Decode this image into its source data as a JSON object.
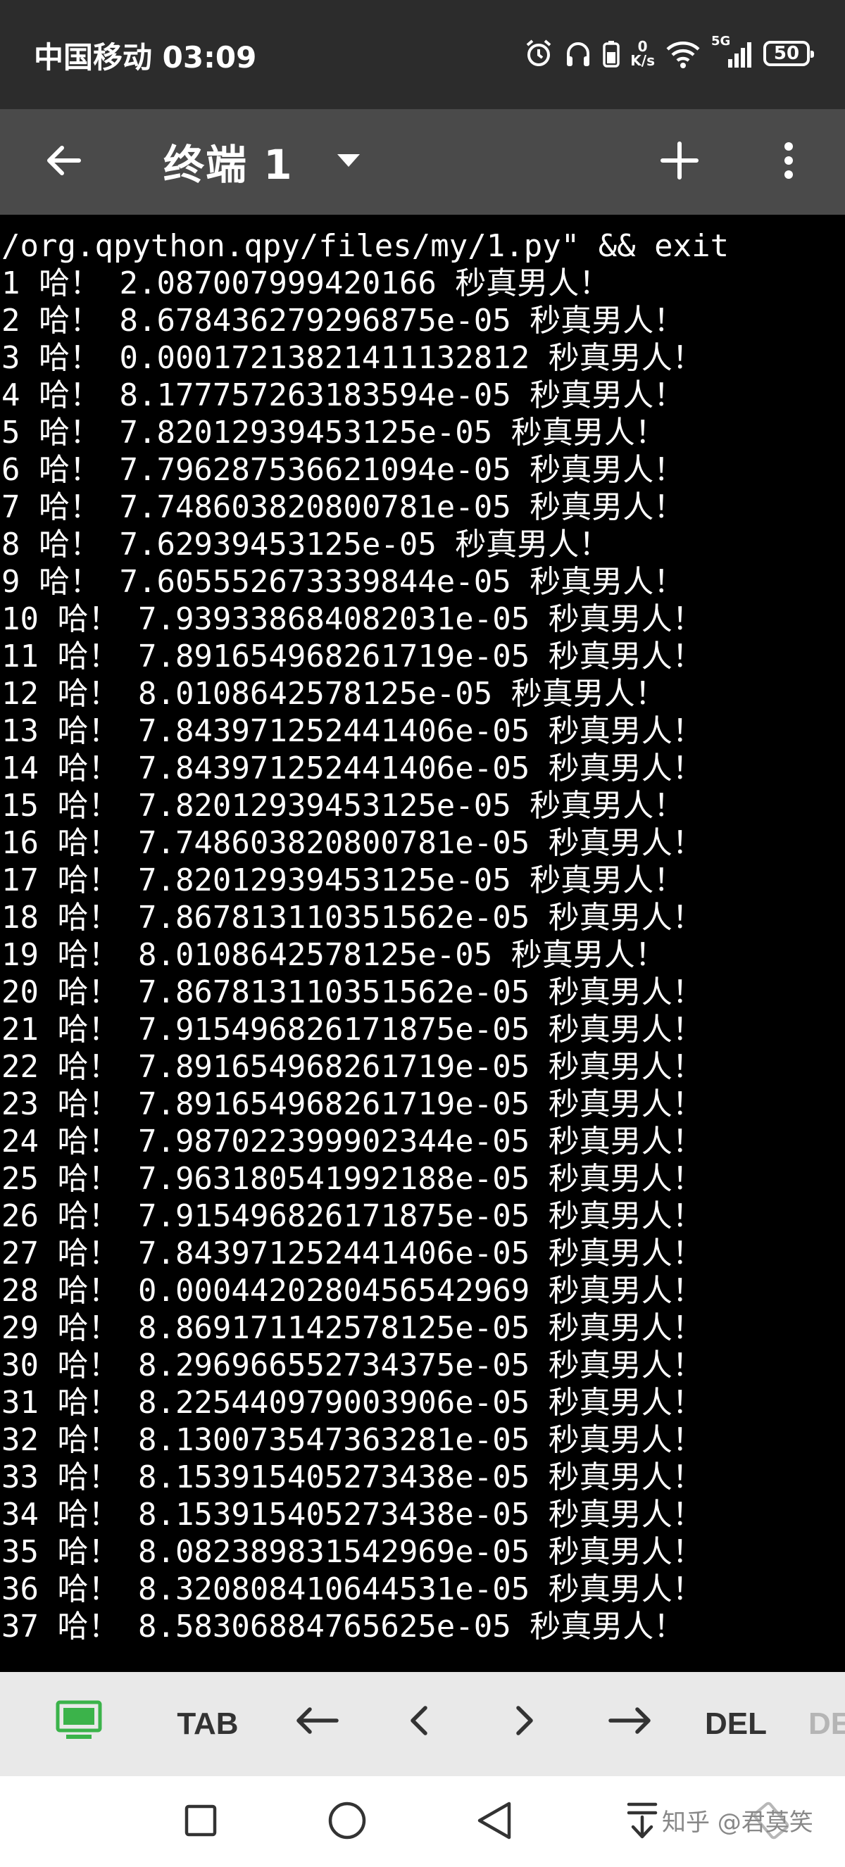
{
  "status_bar": {
    "time": "中国移动 03:09",
    "netspeed_value": "0",
    "netspeed_unit": "K/s",
    "signal_label": "5G",
    "battery": "50"
  },
  "toolbar": {
    "title": "终端 1"
  },
  "terminal": {
    "lines": [
      "/org.qpython.qpy/files/my/1.py\" && exit",
      "1 哈！ 2.087007999420166 秒真男人！",
      "2 哈！ 8.678436279296875e-05 秒真男人！",
      "3 哈！ 0.0001721382141113281​2 秒真男人！",
      "4 哈！ 8.177757263183594e-05 秒真男人！",
      "5 哈！ 7.82012939453125e-05 秒真男人！",
      "6 哈！ 7.796287536621094e-05 秒真男人！",
      "7 哈！ 7.748603820800781e-05 秒真男人！",
      "8 哈！ 7.62939453125e-05 秒真男人！",
      "9 哈！ 7.605552673339844e-05 秒真男人！",
      "10 哈！ 7.939338684082031e-05 秒真男人！",
      "11 哈！ 7.891654968261719e-05 秒真男人！",
      "12 哈！ 8.0108642578125e-05 秒真男人！",
      "13 哈！ 7.843971252441406e-05 秒真男人！",
      "14 哈！ 7.843971252441406e-05 秒真男人！",
      "15 哈！ 7.82012939453125e-05 秒真男人！",
      "16 哈！ 7.748603820800781e-05 秒真男人！",
      "17 哈！ 7.82012939453125e-05 秒真男人！",
      "18 哈！ 7.867813110351562e-05 秒真男人！",
      "19 哈！ 8.0108642578125e-05 秒真男人！",
      "20 哈！ 7.867813110351562e-05 秒真男人！",
      "21 哈！ 7.915496826171875e-05 秒真男人！",
      "22 哈！ 7.891654968261719e-05 秒真男人！",
      "23 哈！ 7.891654968261719e-05 秒真男人！",
      "24 哈！ 7.987022399902344e-05 秒真男人！",
      "25 哈！ 7.963180541992188e-05 秒真男人！",
      "26 哈！ 7.915496826171875e-05 秒真男人！",
      "27 哈！ 7.843971252441406e-05 秒真男人！",
      "28 哈！ 0.0004420280456542969 秒真男人！",
      "29 哈！ 8.869171142578125e-05 秒真男人！",
      "30 哈！ 8.296966552734375e-05 秒真男人！",
      "31 哈！ 8.225440979003906e-05 秒真男人！",
      "32 哈！ 8.130073547363281e-05 秒真男人！",
      "33 哈！ 8.153915405273438e-05 秒真男人！",
      "34 哈！ 8.153915405273438e-05 秒真男人！",
      "35 哈！ 8.082389831542969e-05 秒真男人！",
      "36 哈！ 8.320808410644531e-05 秒真男人！",
      "37 哈！ 8.58306884765625e-05 秒真男人！"
    ]
  },
  "extra_keys": {
    "tab": "TAB",
    "del": "DEL",
    "partial": "DE"
  },
  "nav": {
    "watermark": "知乎 @君莫笑"
  }
}
